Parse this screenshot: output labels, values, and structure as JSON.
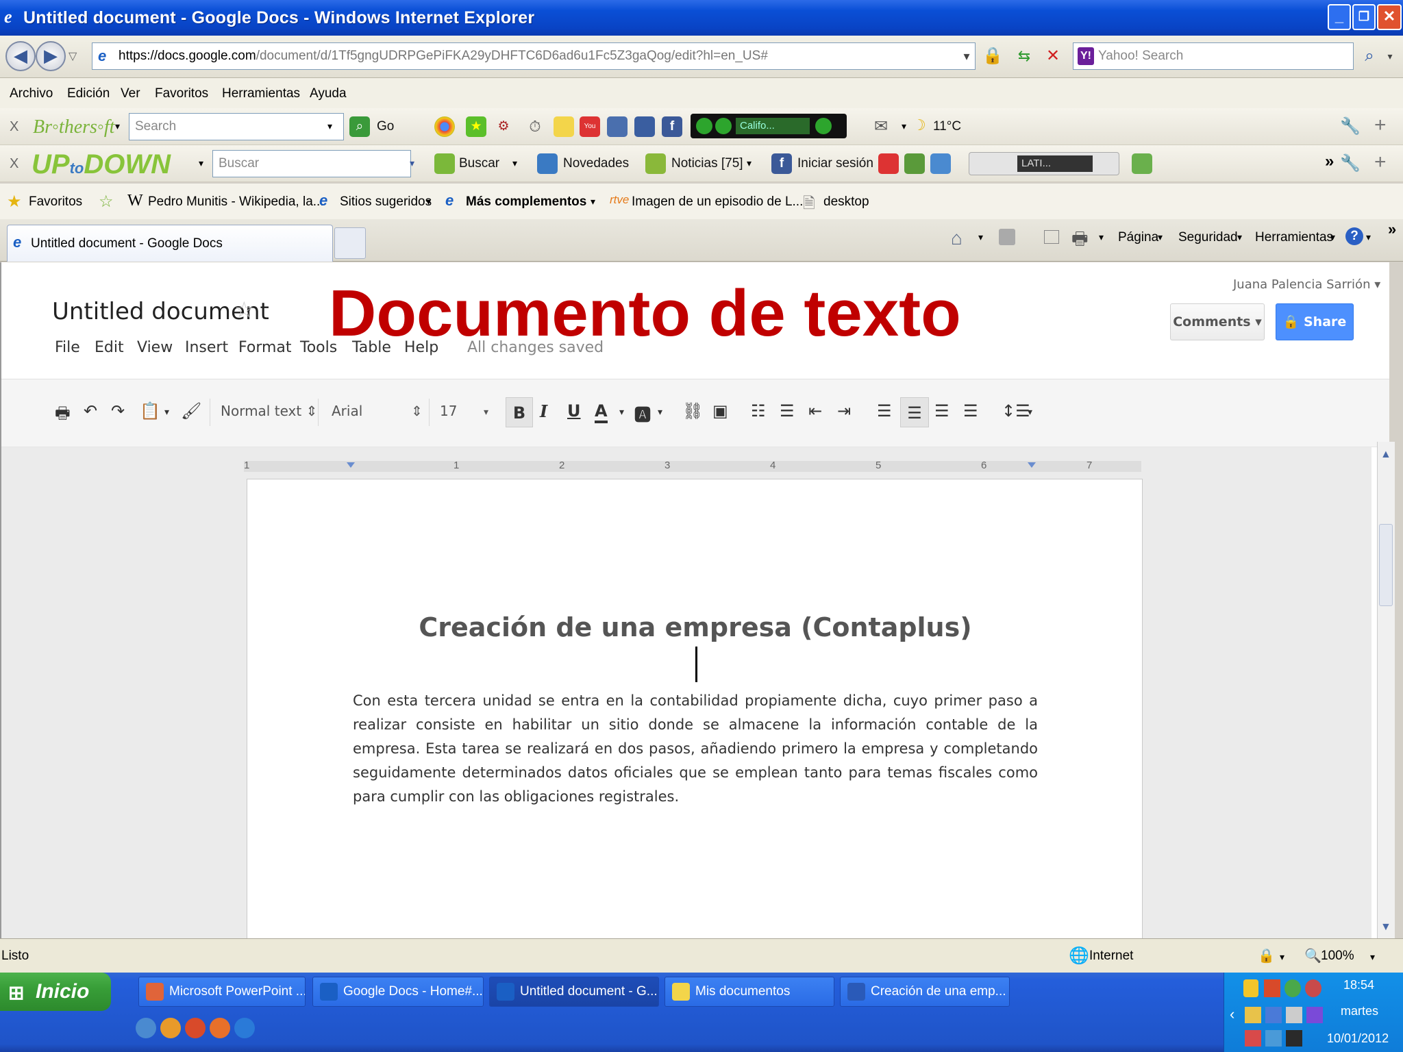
{
  "window": {
    "title": "Untitled document - Google Docs - Windows Internet Explorer"
  },
  "address": {
    "url_prefix": "https://docs.",
    "url_host": "google.com",
    "url_path": "/document/d/1Tf5gngUDRPGePiFKA29yDHFTC6D6ad6u1Fc5Z3gaQog/edit?hl=en_US#",
    "search_placeholder": "Yahoo! Search"
  },
  "menubar": {
    "items": [
      "Archivo",
      "Edición",
      "Ver",
      "Favoritos",
      "Herramientas",
      "Ayuda"
    ]
  },
  "toolbar1": {
    "search_placeholder": "Search",
    "go_label": "Go",
    "player_label": "Califo...",
    "weather": "11°C"
  },
  "toolbar2": {
    "search_placeholder": "Buscar",
    "buscar_label": "Buscar",
    "novedades_label": "Novedades",
    "noticias_label": "Noticias [75]",
    "iniciar_label": "Iniciar sesión",
    "radio_label": "LATI..."
  },
  "favbar": {
    "favoritos": "Favoritos",
    "items": [
      "Pedro Munitis - Wikipedia, la...",
      "Sitios sugeridos",
      "Más complementos",
      "Imagen de un episodio de L...",
      "desktop"
    ]
  },
  "tabbar": {
    "active_tab": "Untitled document - Google Docs",
    "pagina": "Página",
    "seguridad": "Seguridad",
    "herramientas": "Herramientas"
  },
  "docs": {
    "title": "Untitled document",
    "overlay_title": "Documento de texto",
    "menu": [
      "File",
      "Edit",
      "View",
      "Insert",
      "Format",
      "Tools",
      "Table",
      "Help"
    ],
    "save_status": "All changes saved",
    "user": "Juana Palencia Sarrión",
    "comments_label": "Comments",
    "share_label": "Share",
    "style_select": "Normal text",
    "font_select": "Arial",
    "size_select": "17",
    "ruler_marks": [
      "1",
      "1",
      "2",
      "3",
      "4",
      "5",
      "6",
      "7"
    ],
    "heading": "Creación de una empresa (Contaplus)",
    "body": "Con esta tercera unidad se entra en la contabilidad propiamente dicha, cuyo primer paso a realizar consiste en habilitar un sitio donde se almacene la información contable de la empresa. Esta tarea se realizará en dos pasos, añadiendo primero la empresa y completando seguidamente determinados datos oficiales que se emplean tanto para temas fiscales como para cumplir con las obligaciones registrales."
  },
  "statusbar": {
    "status": "Listo",
    "zone": "Internet",
    "zoom": "100%"
  },
  "taskbar": {
    "start_label": "Inicio",
    "tasks": [
      "Microsoft PowerPoint ...",
      "Google Docs - Home#...",
      "Untitled document - G...",
      "Mis documentos",
      "Creación de una emp..."
    ],
    "clock_time": "18:54",
    "clock_day": "martes",
    "clock_date": "10/01/2012"
  }
}
